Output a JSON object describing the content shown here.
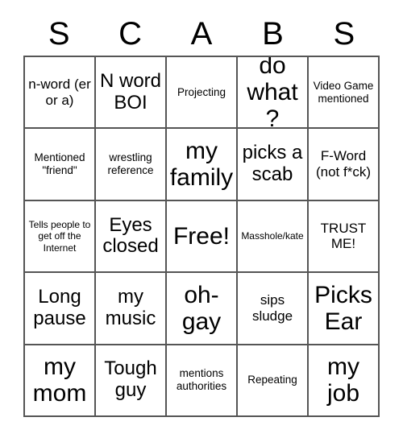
{
  "card": {
    "header_letters": [
      "S",
      "C",
      "A",
      "B",
      "S"
    ],
    "columns": 5,
    "rows": 5,
    "grid_border_color": "#555555",
    "text_color": "#000000",
    "background_color": "#ffffff",
    "cells": [
      {
        "text": "n-word (er or a)",
        "size": "md"
      },
      {
        "text": "N word BOI",
        "size": "lg"
      },
      {
        "text": "Projecting",
        "size": "sm"
      },
      {
        "text": "do what?",
        "size": "xl"
      },
      {
        "text": "Video Game mentioned",
        "size": "sm"
      },
      {
        "text": "Mentioned \"friend\"",
        "size": "sm"
      },
      {
        "text": "wrestling reference",
        "size": "sm"
      },
      {
        "text": "my family",
        "size": "xl"
      },
      {
        "text": "picks a scab",
        "size": "lg"
      },
      {
        "text": "F-Word (not f*ck)",
        "size": "md"
      },
      {
        "text": "Tells people to get off the Internet",
        "size": "xs"
      },
      {
        "text": "Eyes closed",
        "size": "lg"
      },
      {
        "text": "Free!",
        "size": "xl"
      },
      {
        "text": "Masshole/kate",
        "size": "xs"
      },
      {
        "text": "TRUST ME!",
        "size": "md"
      },
      {
        "text": "Long pause",
        "size": "lg"
      },
      {
        "text": "my music",
        "size": "lg"
      },
      {
        "text": "oh-gay",
        "size": "xl"
      },
      {
        "text": "sips sludge",
        "size": "md"
      },
      {
        "text": "Picks Ear",
        "size": "xl"
      },
      {
        "text": "my mom",
        "size": "xl"
      },
      {
        "text": "Tough guy",
        "size": "lg"
      },
      {
        "text": "mentions authorities",
        "size": "sm"
      },
      {
        "text": "Repeating",
        "size": "sm"
      },
      {
        "text": "my job",
        "size": "xl"
      }
    ]
  }
}
